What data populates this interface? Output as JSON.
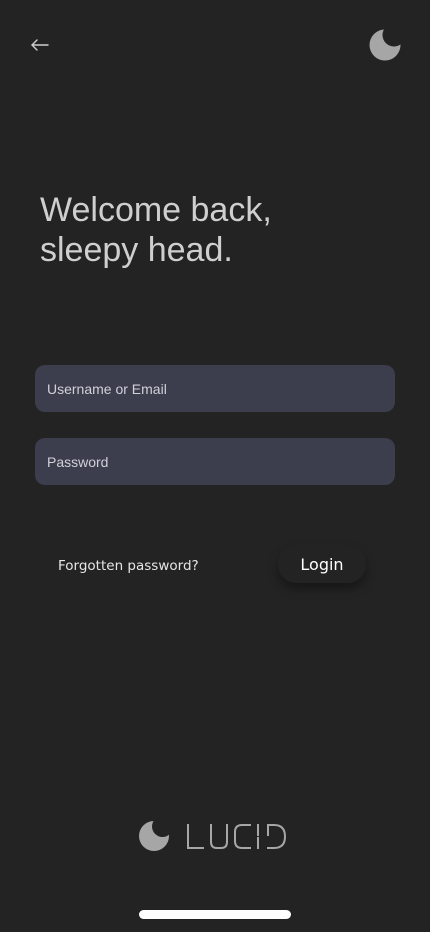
{
  "header": {
    "back_icon": "arrow-left-icon",
    "theme_icon": "moon-icon"
  },
  "welcome": {
    "line1": "Welcome back,",
    "line2": "sleepy head."
  },
  "form": {
    "username": {
      "placeholder": "Username or Email",
      "value": ""
    },
    "password": {
      "placeholder": "Password",
      "value": ""
    },
    "forgot_label": "Forgotten password?",
    "login_label": "Login"
  },
  "brand": {
    "name": "LUCID",
    "icon": "moon-icon"
  },
  "colors": {
    "background": "#232323",
    "field": "#3c3e4e",
    "text": "#d9d9d9",
    "icon": "#a6a6a6"
  }
}
